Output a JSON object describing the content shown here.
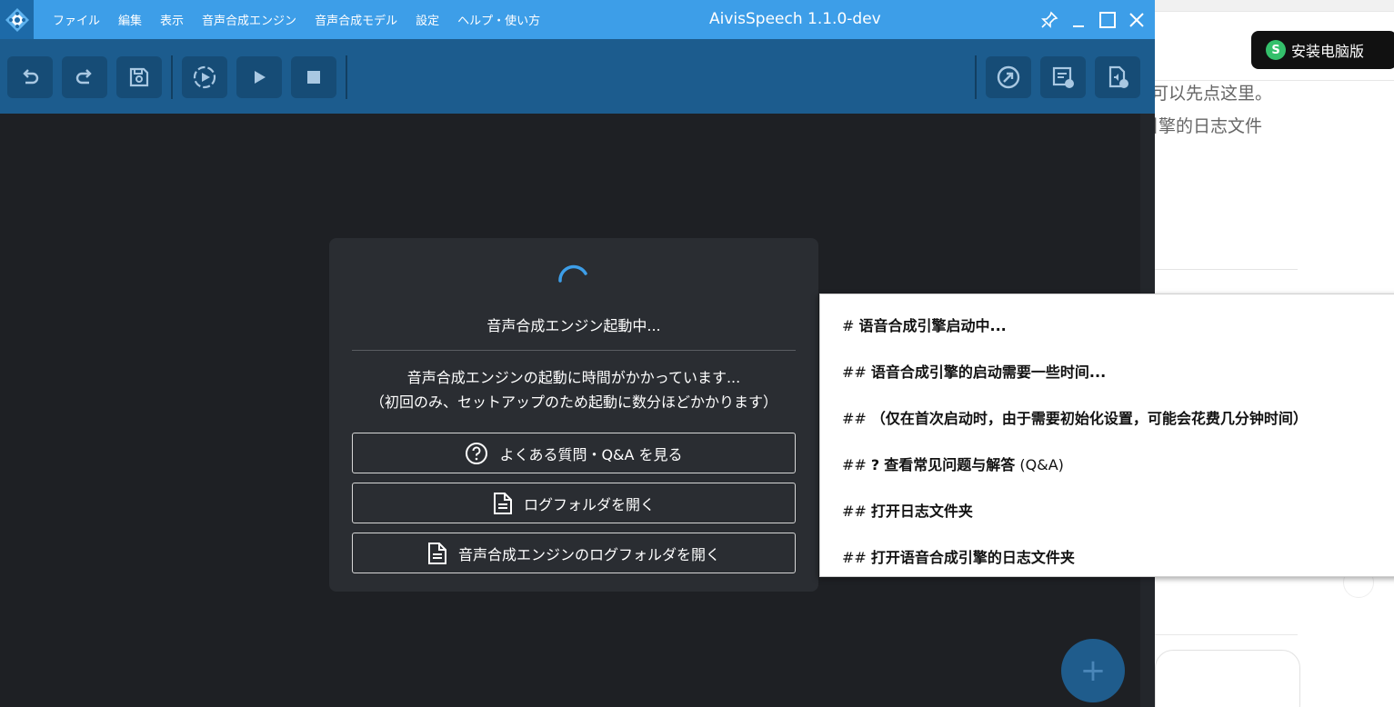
{
  "window": {
    "title": "AivisSpeech 1.1.0-dev"
  },
  "menu": {
    "items": [
      "ファイル",
      "編集",
      "表示",
      "音声合成エンジン",
      "音声合成モデル",
      "設定",
      "ヘルプ・使い方"
    ]
  },
  "toolbar": {
    "left_icons": [
      "undo-icon",
      "redo-icon",
      "save-icon",
      "play-continuous-icon",
      "play-icon",
      "stop-icon"
    ],
    "right_icons": [
      "export-icon",
      "export-text-icon",
      "export-audio-icon"
    ]
  },
  "dialog": {
    "title": "音声合成エンジン起動中...",
    "message_line1": "音声合成エンジンの起動に時間がかかっています...",
    "message_line2": "（初回のみ、セットアップのため起動に数分ほどかかります）",
    "faq_button": "よくある質問・Q&A を見る",
    "open_logs_button": "ログフォルダを開く",
    "open_engine_logs_button": "音声合成エンジンのログフォルダを開く"
  },
  "fab": {
    "label": "+"
  },
  "translation": {
    "line1_hash": "#",
    "line1": "语音合成引擎启动中...",
    "line2_hash": "##",
    "line2": "语音合成引擎的启动需要一些时间...",
    "line3_hash": "##",
    "line3": "（仅在首次启动时，由于需要初始化设置，可能会花费几分钟时间）",
    "line4_hash": "##",
    "line4_mark": "?",
    "line4": "查看常见问题与解答",
    "line4_suffix": "(Q&A)",
    "line5_hash": "##",
    "line5": "打开日志文件夹",
    "line6_hash": "##",
    "line6": "打开语音合成引擎的日志文件夹"
  },
  "background_page": {
    "install_button": "安装电脑版",
    "text1": "可以先点这里。",
    "text2": "引擎的日志文件"
  },
  "colors": {
    "titlebar": "#3d9ee8",
    "toolbar": "#1c5c8e",
    "app_background": "#1e2024",
    "dialog": "#2a2d32",
    "spinner": "#3d9ee8"
  }
}
